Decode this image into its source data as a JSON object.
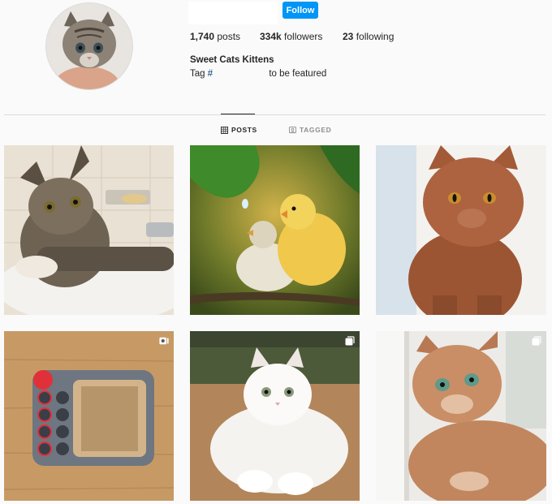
{
  "profile": {
    "avatar_icon": "kitten-avatar",
    "follow_label": "Follow",
    "bio_name": "Sweet Cats Kittens",
    "bio_prefix": "Tag ",
    "bio_hash": "#",
    "bio_suffix": " to be featured"
  },
  "stats": {
    "posts_count": "1,740",
    "posts_label": " posts",
    "followers_count": "334k",
    "followers_label": " followers",
    "following_count": "23",
    "following_label": " following"
  },
  "tabs": [
    {
      "label": "POSTS",
      "icon": "grid-icon",
      "active": true
    },
    {
      "label": "TAGGED",
      "icon": "tagged-icon",
      "active": false
    }
  ],
  "posts": [
    {
      "subject": "tabby kitten in sink",
      "badge": ""
    },
    {
      "subject": "two chicks on branch",
      "badge": ""
    },
    {
      "subject": "ginger british shorthair",
      "badge": ""
    },
    {
      "subject": "cat scratcher toy",
      "badge": "video-icon"
    },
    {
      "subject": "white fluffy cat",
      "badge": "carousel-icon"
    },
    {
      "subject": "orange tabby cat",
      "badge": "carousel-icon"
    }
  ],
  "colors": {
    "accent": "#0095f6",
    "background": "#fafafa",
    "text": "#262626",
    "muted": "#8e8e8e"
  }
}
